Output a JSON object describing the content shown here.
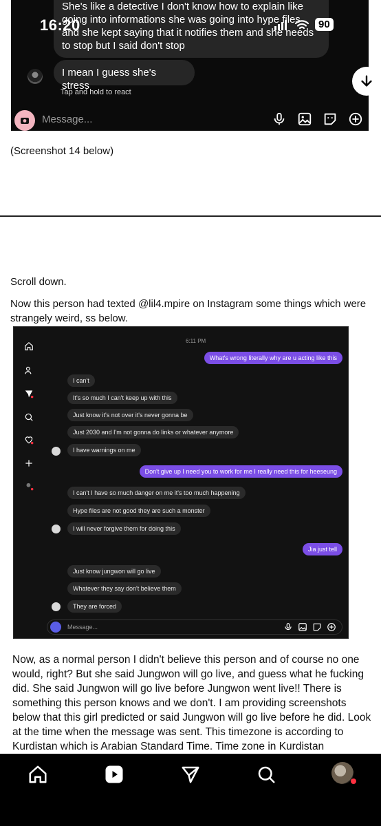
{
  "status_bar": {
    "time": "16:20",
    "battery": "90"
  },
  "top_chat": {
    "message_1": "She's like a detective I don't know how to explain like going into informations she was going into hype files and she kept saying that it notifies them and she needs to stop but I said don't stop",
    "message_2": "I mean I guess she's stress",
    "tap_hint": "Tap and hold to react",
    "message_placeholder": "Message..."
  },
  "document": {
    "screenshot_note": "(Screenshot 14 below)",
    "scroll_note": "Scroll down.",
    "intro": "Now this person had texted @lil4.mpire on Instagram some things which were strangely weird, ss below.",
    "paragraph": "Now, as a normal person I didn't believe this person and of course no one would, right? But she said Jungwon will go live, and guess what he fucking did. She said Jungwon will go live before Jungwon went live!! There is something this person knows and we don't. I am providing screenshots below that this girl predicted or said Jungwon will go live before he did. Look at the time when the message was sent. This timezone is according to Kurdistan which is Arabian Standard Time. Time zone in Kurdistan"
  },
  "ig_screenshot": {
    "timestamp": "6:11 PM",
    "messages": [
      {
        "side": "out",
        "text": "What's wrong literally why are u acting like this"
      },
      {
        "side": "in",
        "text": "I can't"
      },
      {
        "side": "in",
        "text": "It's so much I can't keep up with this"
      },
      {
        "side": "in",
        "text": "Just know it's not over it's never gonna be"
      },
      {
        "side": "in",
        "text": "Just 2030 and I'm not gonna do links or whatever anymore"
      },
      {
        "side": "in",
        "text": "I have warnings on me"
      },
      {
        "side": "out",
        "text": "Don't give up I need you to work for me I really need this for heeseung"
      },
      {
        "side": "in",
        "text": "I can't I have so much danger on me it's too much happening"
      },
      {
        "side": "in",
        "text": "Hype files are not good they are such a monster"
      },
      {
        "side": "in",
        "text": "I will never forgive them for doing this"
      },
      {
        "side": "out",
        "text": "Jia just tell"
      },
      {
        "side": "in",
        "text": "Just know jungwon will go live"
      },
      {
        "side": "in",
        "text": "Whatever they say don't believe them"
      },
      {
        "side": "in",
        "text": "They are forced"
      }
    ],
    "message_placeholder": "Message..."
  },
  "bottom_nav": {
    "items": [
      "home-icon",
      "reels-icon",
      "send-icon",
      "search-icon",
      "profile-avatar"
    ]
  }
}
